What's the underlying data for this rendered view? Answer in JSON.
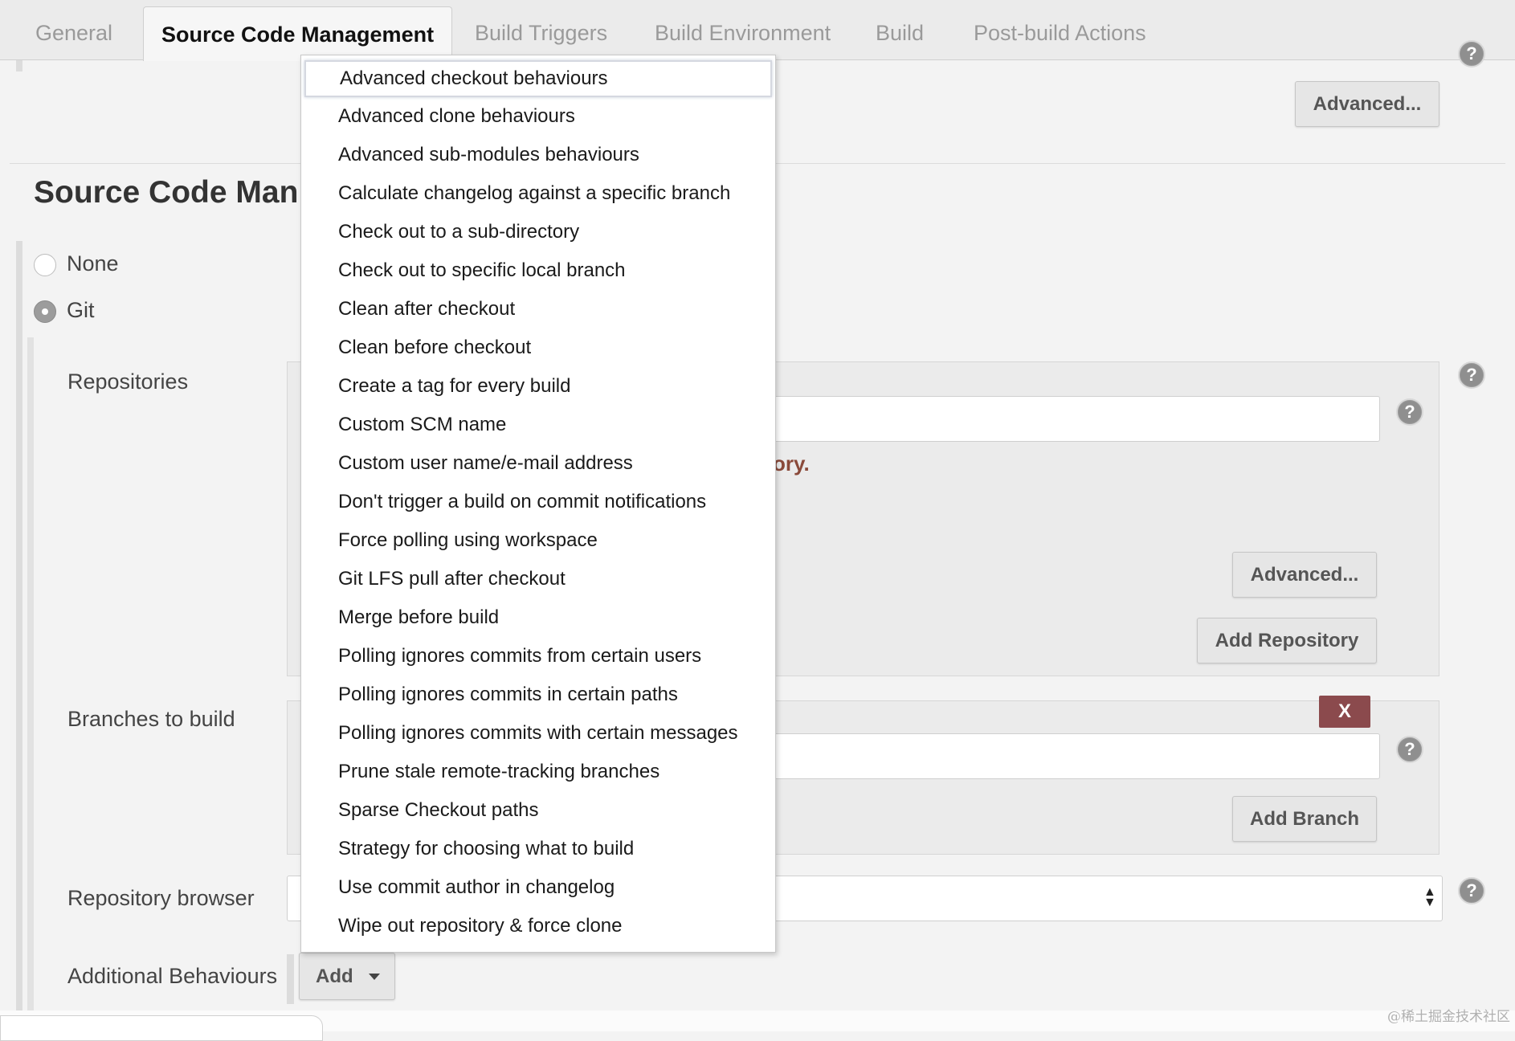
{
  "tabs": [
    {
      "label": "General"
    },
    {
      "label": "Source Code Management"
    },
    {
      "label": "Build Triggers"
    },
    {
      "label": "Build Environment"
    },
    {
      "label": "Build"
    },
    {
      "label": "Post-build Actions"
    }
  ],
  "top_advanced_label": "Advanced...",
  "section_title": "Source Code Man",
  "scm": {
    "none_label": "None",
    "git_label": "Git"
  },
  "fields": {
    "repositories": "Repositories",
    "branches": "Branches to build",
    "repo_browser": "Repository browser",
    "additional": "Additional Behaviours"
  },
  "repo": {
    "hint_fragment": "ory.",
    "advanced_label": "Advanced...",
    "add_repo_label": "Add Repository"
  },
  "branches": {
    "delete_label": "X",
    "add_branch_label": "Add Branch"
  },
  "add_button_label": "Add",
  "menu_items": [
    "Advanced checkout behaviours",
    "Advanced clone behaviours",
    "Advanced sub-modules behaviours",
    "Calculate changelog against a specific branch",
    "Check out to a sub-directory",
    "Check out to specific local branch",
    "Clean after checkout",
    "Clean before checkout",
    "Create a tag for every build",
    "Custom SCM name",
    "Custom user name/e-mail address",
    "Don't trigger a build on commit notifications",
    "Force polling using workspace",
    "Git LFS pull after checkout",
    "Merge before build",
    "Polling ignores commits from certain users",
    "Polling ignores commits in certain paths",
    "Polling ignores commits with certain messages",
    "Prune stale remote-tracking branches",
    "Sparse Checkout paths",
    "Strategy for choosing what to build",
    "Use commit author in changelog",
    "Wipe out repository & force clone"
  ],
  "watermark": "@稀土掘金技术社区",
  "colors": {
    "delete_button": "#8b4a4d",
    "hint_text": "#8a4a3a",
    "active_tab_bg": "#f6f6f6"
  }
}
